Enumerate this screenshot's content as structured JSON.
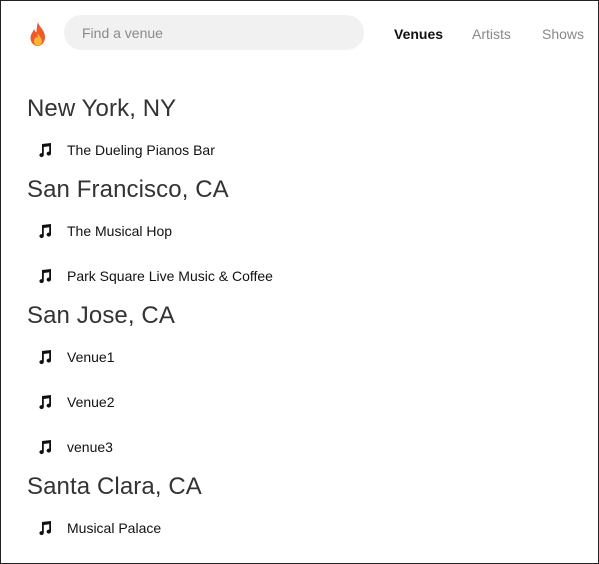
{
  "header": {
    "logo_icon": "flame-icon",
    "search_placeholder": "Find a venue",
    "nav": [
      {
        "label": "Venues",
        "active": true
      },
      {
        "label": "Artists",
        "active": false
      },
      {
        "label": "Shows",
        "active": false
      }
    ]
  },
  "cities": [
    {
      "name": "New York, NY",
      "venues": [
        "The Dueling Pianos Bar"
      ]
    },
    {
      "name": "San Francisco, CA",
      "venues": [
        "The Musical Hop",
        "Park Square Live Music & Coffee"
      ]
    },
    {
      "name": "San Jose, CA",
      "venues": [
        "Venue1",
        "Venue2",
        "venue3"
      ]
    },
    {
      "name": "Santa Clara, CA",
      "venues": [
        "Musical Palace"
      ]
    }
  ],
  "colors": {
    "accent_flame": "#f0592a",
    "search_bg": "#f1f1f1",
    "nav_inactive": "#888888"
  }
}
